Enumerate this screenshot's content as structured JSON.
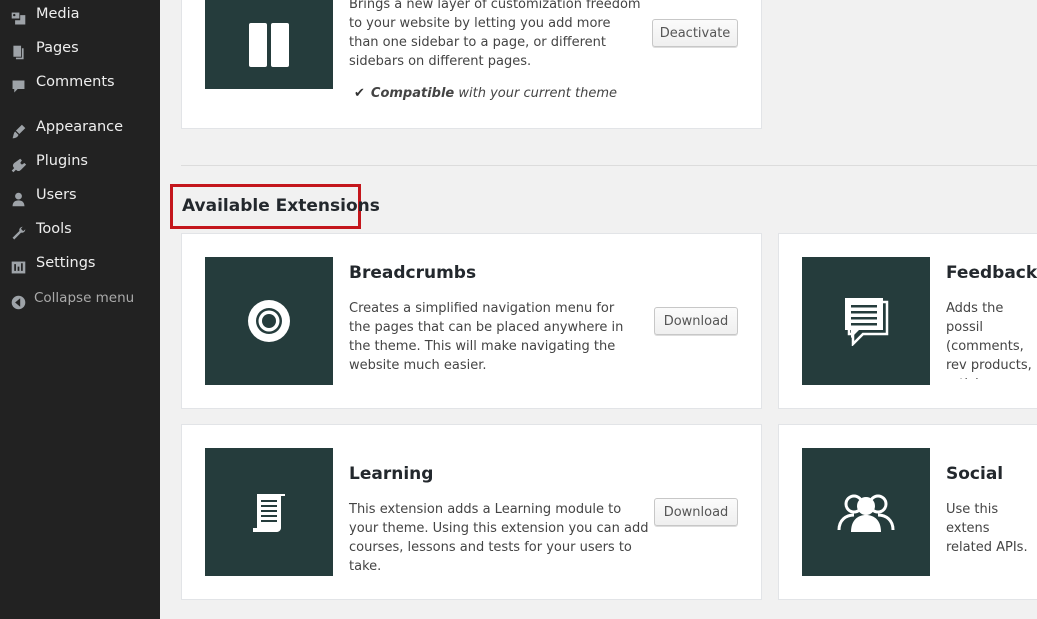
{
  "sidebar": {
    "items": [
      {
        "label": "Media",
        "icon": "media-icon"
      },
      {
        "label": "Pages",
        "icon": "pages-icon"
      },
      {
        "label": "Comments",
        "icon": "comments-icon"
      },
      {
        "label": "Appearance",
        "icon": "appearance-icon"
      },
      {
        "label": "Plugins",
        "icon": "plugins-icon"
      },
      {
        "label": "Users",
        "icon": "users-icon"
      },
      {
        "label": "Tools",
        "icon": "tools-icon"
      },
      {
        "label": "Settings",
        "icon": "settings-icon"
      }
    ],
    "collapse_label": "Collapse menu"
  },
  "top_extension": {
    "description": "Brings a new layer of customization freedom to your website by letting you add more than one sidebar to a page, or different sidebars on different pages.",
    "button_label": "Deactivate",
    "compat_bold": "Compatible",
    "compat_rest": " with your current theme"
  },
  "section": {
    "heading": "Available Extensions"
  },
  "extensions": [
    {
      "title": "Breadcrumbs",
      "description": "Creates a simplified navigation menu for the pages that can be placed anywhere in the theme. This will make navigating the website much easier.",
      "button_label": "Download",
      "icon": "breadcrumbs-target-icon"
    },
    {
      "title": "Feedback",
      "description": "Adds the possil (comments, rev products, articl comments syst",
      "icon": "feedback-chat-icon"
    },
    {
      "title": "Learning",
      "description": "This extension adds a Learning module to your theme. Using this extension you can add courses, lessons and tests for your users to take.",
      "button_label": "Download",
      "icon": "learning-scroll-icon"
    },
    {
      "title": "Social",
      "description": "Use this extens related APIs. Ot extension to cc",
      "icon": "social-users-icon"
    }
  ],
  "colors": {
    "sidebar_bg": "#222222",
    "thumb_bg": "#253c3c",
    "highlight_border": "#c4161c",
    "page_bg": "#f1f1f1"
  }
}
